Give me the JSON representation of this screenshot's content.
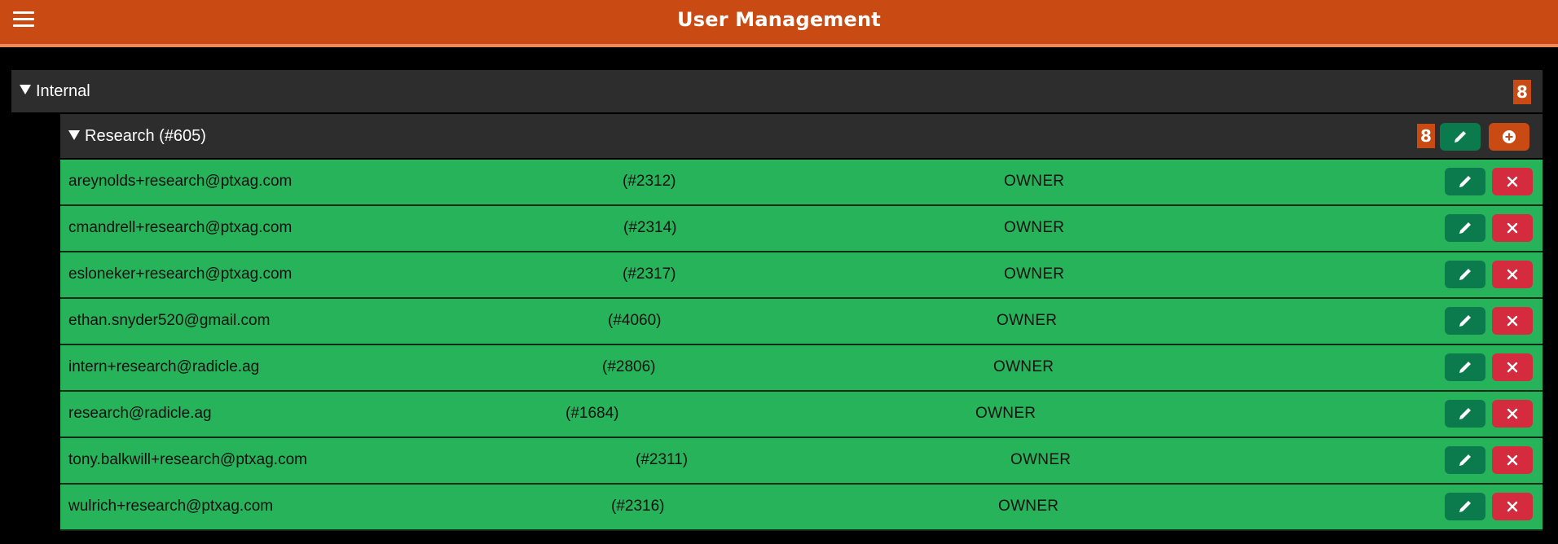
{
  "app": {
    "title": "User Management",
    "accent": "#c94b13"
  },
  "group": {
    "label": "Internal",
    "count": "8"
  },
  "subgroup": {
    "label": "Research (#605)",
    "count": "8"
  },
  "icons": {
    "menu": "hamburger-menu-icon",
    "expand": "caret-down-icon",
    "edit": "pencil-icon",
    "add": "plus-circle-icon",
    "delete": "close-x-icon"
  },
  "members": [
    {
      "email": "areynolds+research@ptxag.com",
      "id": "(#2312)",
      "role": "OWNER"
    },
    {
      "email": "cmandrell+research@ptxag.com",
      "id": "(#2314)",
      "role": "OWNER"
    },
    {
      "email": "esloneker+research@ptxag.com",
      "id": "(#2317)",
      "role": "OWNER"
    },
    {
      "email": "ethan.snyder520@gmail.com",
      "id": "(#4060)",
      "role": "OWNER"
    },
    {
      "email": "intern+research@radicle.ag",
      "id": "(#2806)",
      "role": "OWNER"
    },
    {
      "email": "research@radicle.ag",
      "id": "(#1684)",
      "role": "OWNER"
    },
    {
      "email": "tony.balkwill+research@ptxag.com",
      "id": "(#2311)",
      "role": "OWNER"
    },
    {
      "email": "wulrich+research@ptxag.com",
      "id": "(#2316)",
      "role": "OWNER"
    }
  ]
}
